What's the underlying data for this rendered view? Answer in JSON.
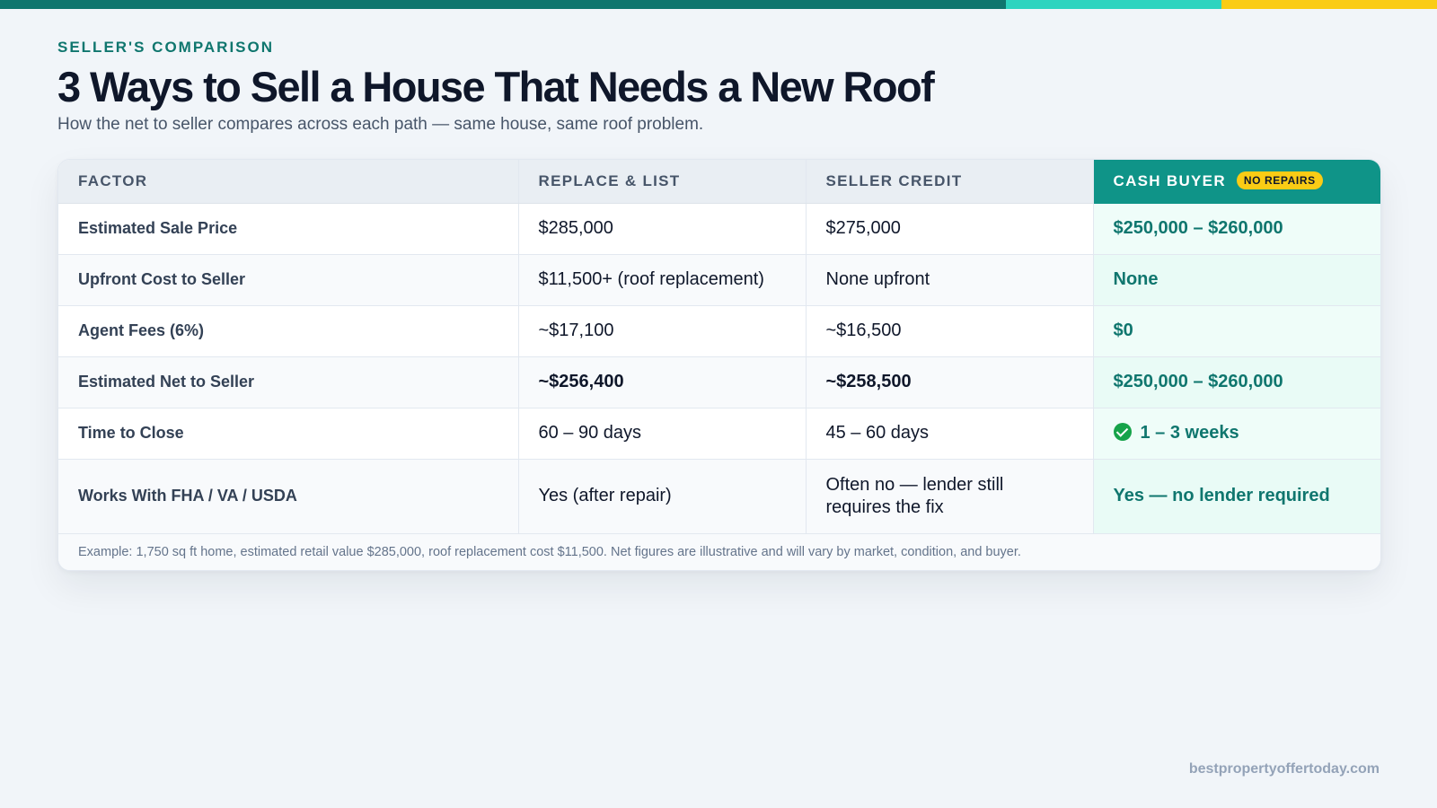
{
  "colors": {
    "bar_primary": "#0f766e",
    "bar_secondary": "#2dd4bf",
    "bar_accent": "#facc15",
    "eyebrow": "#0f766e",
    "cash_header": "#0f9488",
    "badge": "#facc15",
    "check": "#16a34a"
  },
  "header": {
    "eyebrow": "SELLER'S COMPARISON",
    "title": "3 Ways to Sell a House That Needs a New Roof",
    "subtitle": "How the net to seller compares across each path — same house, same roof problem."
  },
  "table": {
    "columns": {
      "factor": "FACTOR",
      "replace": "REPLACE & LIST",
      "credit": "SELLER CREDIT",
      "cash": "CASH BUYER",
      "cash_badge": "NO REPAIRS"
    },
    "rows": [
      {
        "factor": "Estimated Sale Price",
        "replace": "$285,000",
        "credit": "$275,000",
        "cash": "$250,000 – $260,000"
      },
      {
        "factor": "Upfront Cost to Seller",
        "replace": "$11,500+ (roof replacement)",
        "credit": "None upfront",
        "cash": "None"
      },
      {
        "factor": "Agent Fees (6%)",
        "replace": "~$17,100",
        "credit": "~$16,500",
        "cash": "$0"
      },
      {
        "factor": "Estimated Net to Seller",
        "replace": "~$256,400",
        "credit": "~$258,500",
        "cash": "$250,000 – $260,000"
      },
      {
        "factor": "Time to Close",
        "replace": "60 – 90 days",
        "credit": "45 – 60 days",
        "cash": "1 – 3 weeks",
        "cash_icon": "check-circle-icon"
      },
      {
        "factor": "Works With FHA / VA / USDA",
        "replace": "Yes (after repair)",
        "credit": "Often no — lender still requires the fix",
        "cash": "Yes — no lender required"
      }
    ],
    "footnote": "Example: 1,750 sq ft home, estimated retail value $285,000, roof replacement cost $11,500. Net figures are illustrative and will vary by market, condition, and buyer."
  },
  "footer": {
    "site": "bestpropertyoffertoday.com"
  }
}
